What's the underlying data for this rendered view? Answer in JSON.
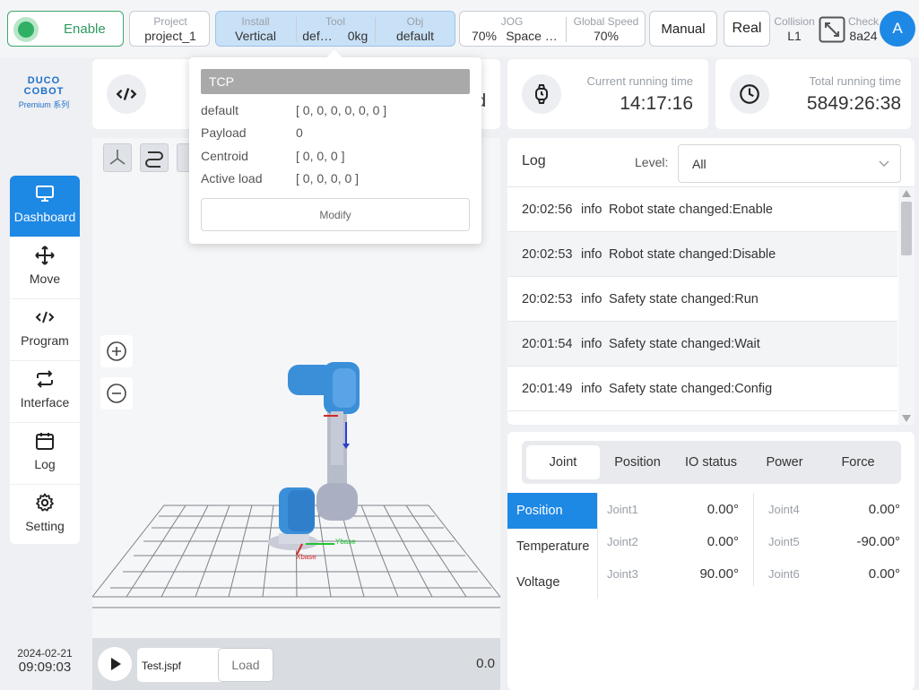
{
  "topbar": {
    "enable_label": "Enable",
    "project_label": "Project",
    "project_value": "project_1",
    "install_label": "Install",
    "install_value": "Vertical",
    "tool_label": "Tool",
    "tool_value": "def…",
    "tool_load": "0kg",
    "obj_label": "Obj",
    "obj_value": "default",
    "jog_label": "JOG",
    "jog_value": "70%",
    "jog_space": "Space …",
    "global_speed_label": "Global Speed",
    "global_speed_value": "70%",
    "manual_label": "Manual",
    "real_label": "Real",
    "collision_label": "Collision",
    "collision_value": "L1",
    "check_label": "Check",
    "check_value": "8a24",
    "avatar_letter": "A"
  },
  "logo": {
    "main": "DUCO COBOT",
    "sub": "Premium 系列"
  },
  "nav": {
    "items": [
      {
        "label": "Dashboard",
        "icon": "monitor-icon"
      },
      {
        "label": "Move",
        "icon": "move-arrows-icon"
      },
      {
        "label": "Program",
        "icon": "code-icon"
      },
      {
        "label": "Interface",
        "icon": "swap-icon"
      },
      {
        "label": "Log",
        "icon": "calendar-icon"
      },
      {
        "label": "Setting",
        "icon": "gear-icon"
      }
    ]
  },
  "datetime": {
    "date": "2024-02-21",
    "time": "09:09:03"
  },
  "program_card": {
    "icon": "code-icon",
    "status_fragment": "d"
  },
  "current_time": {
    "label": "Current running time",
    "value": "14:17:16",
    "icon": "watch-icon"
  },
  "total_time": {
    "label": "Total running time",
    "value": "5849:26:38",
    "icon": "clock-icon"
  },
  "tcp_popup": {
    "title": "TCP",
    "rows": [
      {
        "key": "default",
        "value": "[ 0, 0, 0, 0, 0, 0 ]"
      },
      {
        "key": "Payload",
        "value": "0"
      },
      {
        "key": "Centroid",
        "value": "[ 0, 0, 0 ]"
      },
      {
        "key": "Active load",
        "value": "[ 0, 0, 0, 0 ]"
      }
    ],
    "modify_label": "Modify"
  },
  "viewer": {
    "axis_x": "Xbase",
    "axis_y": "Ybase",
    "file_name": "Test.jspf",
    "load_label": "Load",
    "progress_value": "0.0"
  },
  "log": {
    "title": "Log",
    "level_label": "Level:",
    "level_value": "All",
    "entries": [
      {
        "time": "20:02:56",
        "level": "info",
        "message": "Robot state changed:Enable"
      },
      {
        "time": "20:02:53",
        "level": "info",
        "message": "Robot state changed:Disable"
      },
      {
        "time": "20:02:53",
        "level": "info",
        "message": "Safety state changed:Run"
      },
      {
        "time": "20:01:54",
        "level": "info",
        "message": "Safety state changed:Wait"
      },
      {
        "time": "20:01:49",
        "level": "info",
        "message": "Safety state changed:Config"
      }
    ]
  },
  "joint_panel": {
    "tabs": [
      "Joint",
      "Position",
      "IO status",
      "Power",
      "Force"
    ],
    "side_tabs": [
      "Position",
      "Temperature",
      "Voltage"
    ],
    "joints": [
      {
        "name": "Joint1",
        "value": "0.00°"
      },
      {
        "name": "Joint2",
        "value": "0.00°"
      },
      {
        "name": "Joint3",
        "value": "90.00°"
      },
      {
        "name": "Joint4",
        "value": "0.00°"
      },
      {
        "name": "Joint5",
        "value": "-90.00°"
      },
      {
        "name": "Joint6",
        "value": "0.00°"
      }
    ]
  },
  "colors": {
    "accent": "#1e88e5",
    "enable_green": "#2fb065",
    "robot_blue": "#3b8fd9"
  }
}
